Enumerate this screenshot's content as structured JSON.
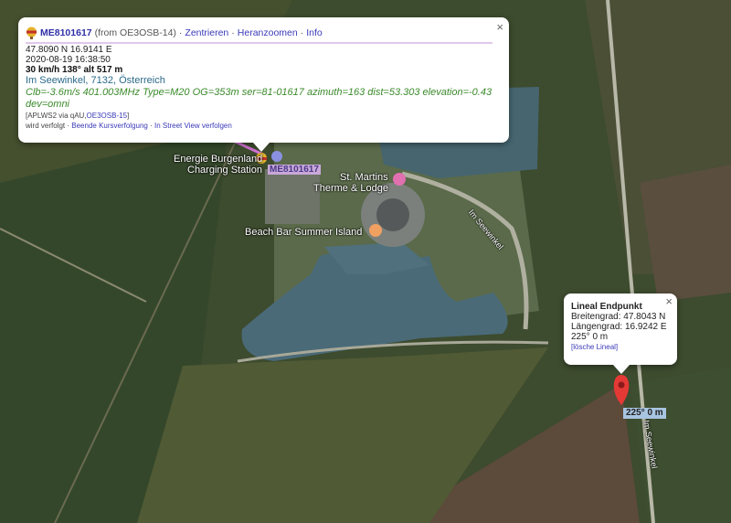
{
  "balloon_popup": {
    "callsign": "ME8101617",
    "from": "(from OE3OSB-14)",
    "sep": "·",
    "links": [
      "Zentrieren",
      "Heranzoomen",
      "Info"
    ],
    "position": "47.8090 N 16.9141 E",
    "timestamp": "2020-08-19 16:38:50",
    "motion": "30 km/h 138° alt 517 m",
    "address": "Im Seewinkel, 7132, Österreich",
    "comment": "Clb=-3.6m/s 401.003MHz Type=M20 OG=353m ser=81-01617 azimuth=163 dist=53.303 elevation=-0.43 dev=omni",
    "path_prefix": "[APLWS2 via qAU,",
    "path_link": "OE3OSB-15",
    "path_suffix": "]",
    "tracking": "wird verfolgt",
    "tracking_links": [
      "Beende Kursverfolgung",
      "In Street View verfolgen"
    ],
    "close": "×"
  },
  "ruler_popup": {
    "title": "Lineal Endpunkt",
    "lat": "Breitengrad: 47.8043 N",
    "lon": "Längengrad: 16.9242 E",
    "bearing": "225° 0 m",
    "delete": "[lösche Lineal]",
    "close": "×"
  },
  "map_labels": {
    "charging": "Energie Burgenland",
    "charging2": "Charging Station",
    "station_tag": "ME8101617",
    "therme": "St. Martins",
    "therme2": "Therme & Lodge",
    "beach": "Beach Bar Summer Island",
    "road1": "Im Seewinkel",
    "road2": "Im Seewinkel",
    "scale": "225° 0 m"
  },
  "colors": {
    "water": "#4a6a78",
    "marker": "#e53935",
    "link": "#3a3ab8"
  }
}
